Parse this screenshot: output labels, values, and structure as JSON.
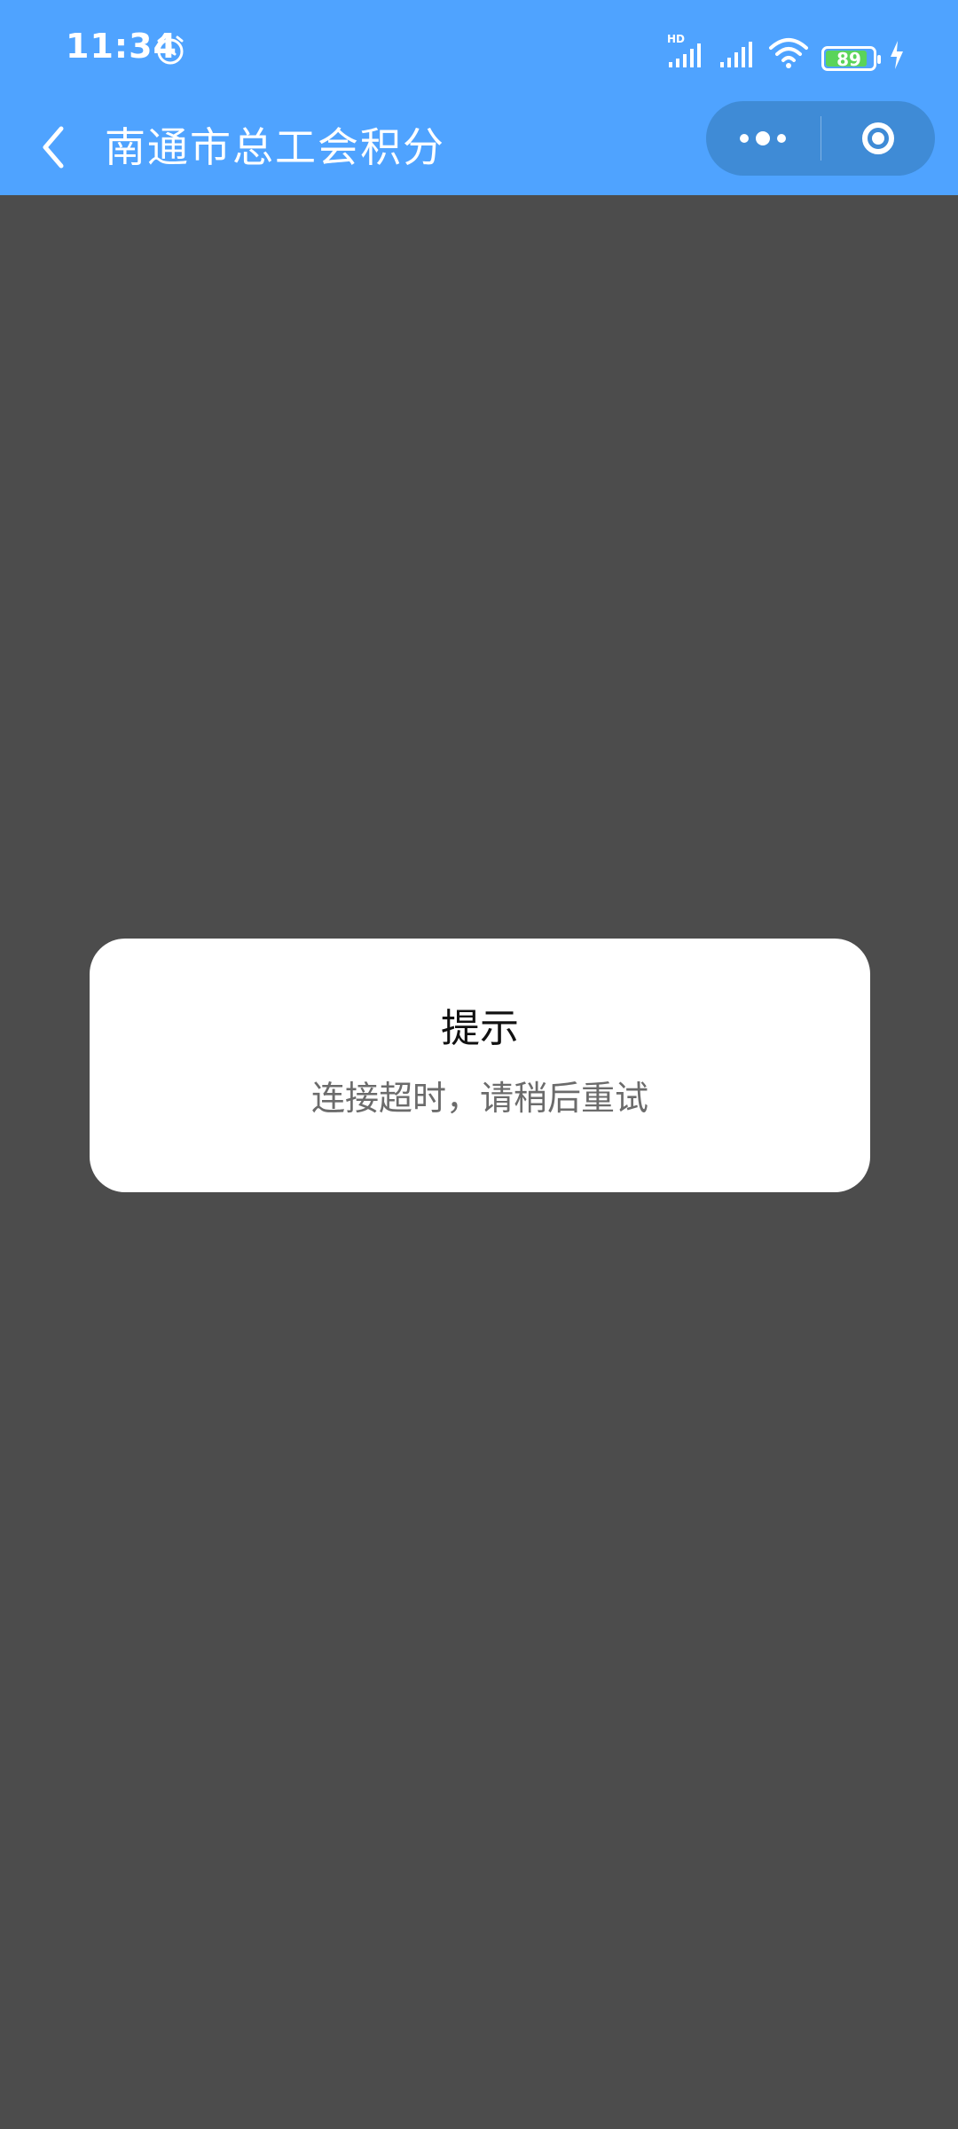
{
  "status_bar": {
    "time": "11:34",
    "battery_percent": "89",
    "battery_level": 0.89,
    "icons": [
      "alarm-icon",
      "hd-signal-icon",
      "signal-icon",
      "wifi-icon",
      "battery-icon",
      "charging-icon"
    ]
  },
  "nav": {
    "title": "南通市总工会积分",
    "back_icon": "chevron-left-icon",
    "capsule_icons": [
      "more-icon",
      "close-target-icon"
    ]
  },
  "dialog": {
    "title": "提示",
    "message": "连接超时，请稍后重试"
  },
  "colors": {
    "nav_background": "#4fa3ff",
    "page_overlay": "#4c4c4c",
    "dialog_background": "#ffffff",
    "battery_fill": "#5ad45a"
  }
}
